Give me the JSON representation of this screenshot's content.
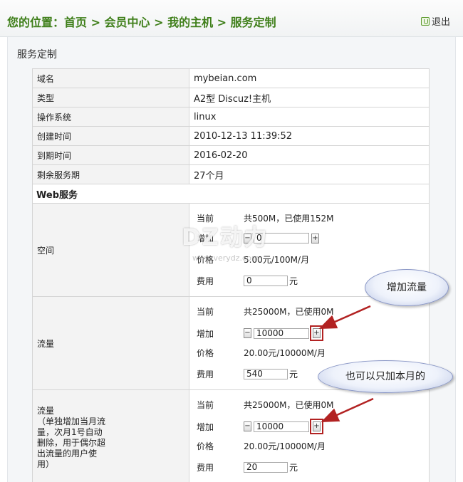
{
  "header": {
    "breadcrumb": "您的位置：首页 > 会员中心 > 我的主机 > 服务定制",
    "logout": "退出"
  },
  "section_title": "服务定制",
  "info": [
    {
      "label": "域名",
      "value": "mybeian.com"
    },
    {
      "label": "类型",
      "value": "A2型  Discuz!主机"
    },
    {
      "label": "操作系统",
      "value": "linux"
    },
    {
      "label": "创建时间",
      "value": "2010-12-13 11:39:52"
    },
    {
      "label": "到期时间",
      "value": "2016-02-20"
    },
    {
      "label": "剩余服务期",
      "value": "27个月"
    }
  ],
  "web_service": "Web服务",
  "groups": [
    {
      "label": "空间",
      "current_label": "当前",
      "current": "共500M，已使用152M",
      "add_label": "增加",
      "add_value": "0",
      "price_label": "价格",
      "price": "5.00元/100M/月",
      "fee_label": "费用",
      "fee": "0",
      "unit": "元",
      "minus": "−",
      "plus": "+"
    },
    {
      "label": "流量",
      "current_label": "当前",
      "current": "共25000M，已使用0M",
      "add_label": "增加",
      "add_value": "10000",
      "price_label": "价格",
      "price": "20.00元/10000M/月",
      "fee_label": "费用",
      "fee": "540",
      "unit": "元",
      "minus": "−",
      "plus": "+"
    },
    {
      "label": "流量\n（单独增加当月流量，次月1号自动删除，用于偶尔超出流量的用户使用）",
      "current_label": "当前",
      "current": "共25000M，已使用0M",
      "add_label": "增加",
      "add_value": "10000",
      "price_label": "价格",
      "price": "20.00元/10000M/月",
      "fee_label": "费用",
      "fee": "20",
      "unit": "元",
      "minus": "−",
      "plus": "+"
    }
  ],
  "watermark": {
    "main": "DZ动力",
    "url": "www.verydz.com"
  },
  "callouts": [
    "增加流量",
    "也可以只加本月的"
  ],
  "colors": {
    "breadcrumb": "#3f7f1a",
    "highlight": "#b22222",
    "arrow": "#b22222"
  }
}
